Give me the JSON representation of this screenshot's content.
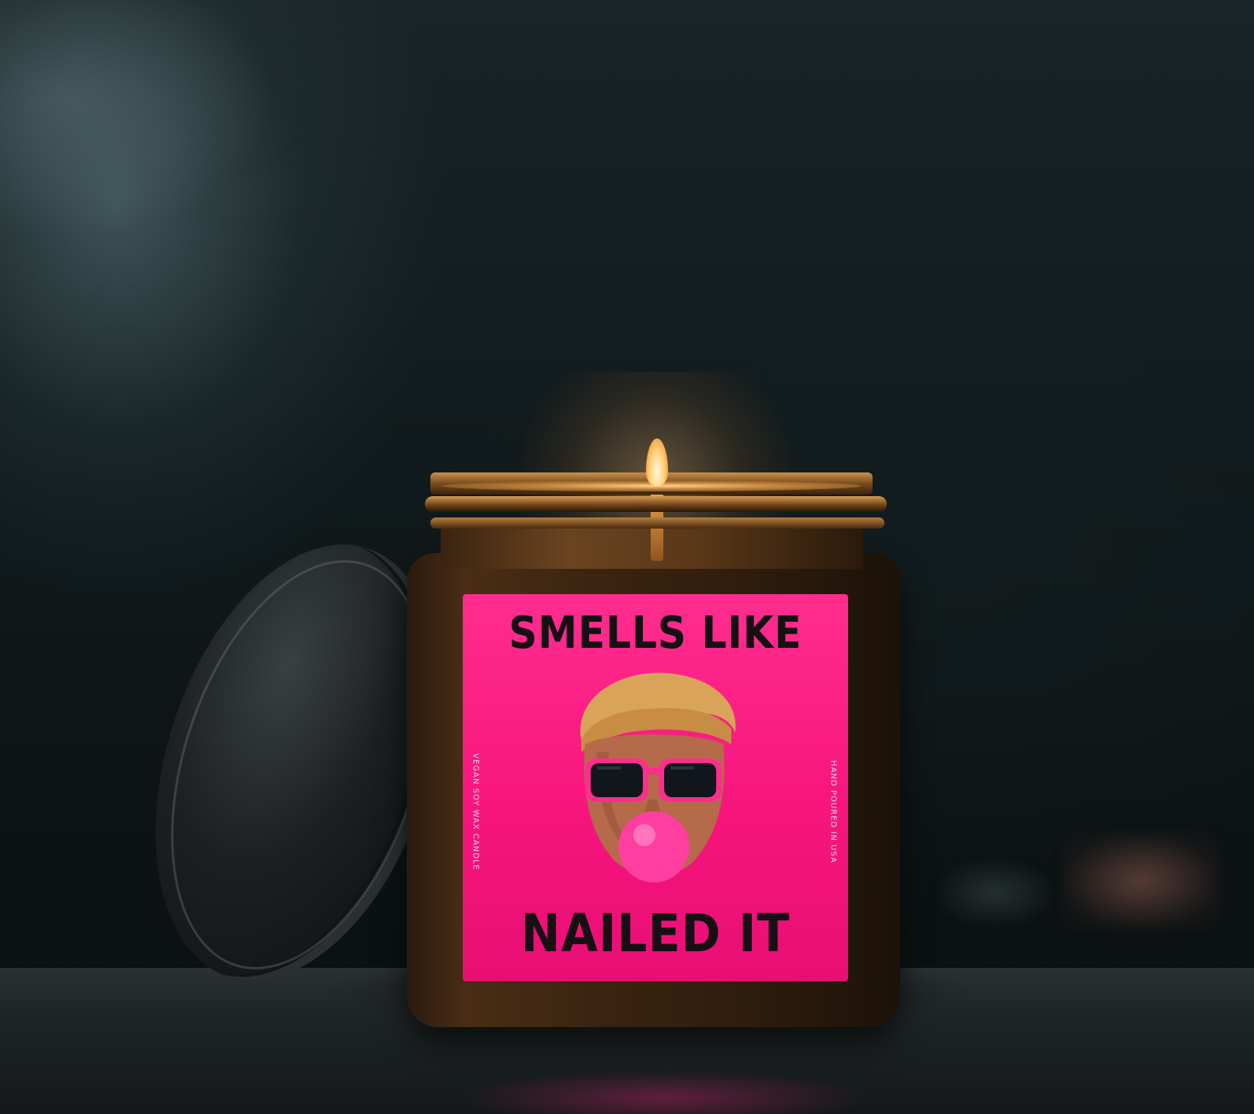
{
  "label": {
    "top_text": "SMELLS LIKE",
    "bottom_text": "NAILED IT",
    "left_side_text": "VEGAN SOY WAX CANDLE",
    "right_side_text": "HAND POURED IN USA"
  },
  "colors": {
    "label_pink": "#f7157d",
    "text_dark": "#161014",
    "amber_jar": "#4a2d15"
  },
  "icons": {
    "face": "face-illustration-icon",
    "flame": "candle-flame-icon"
  }
}
